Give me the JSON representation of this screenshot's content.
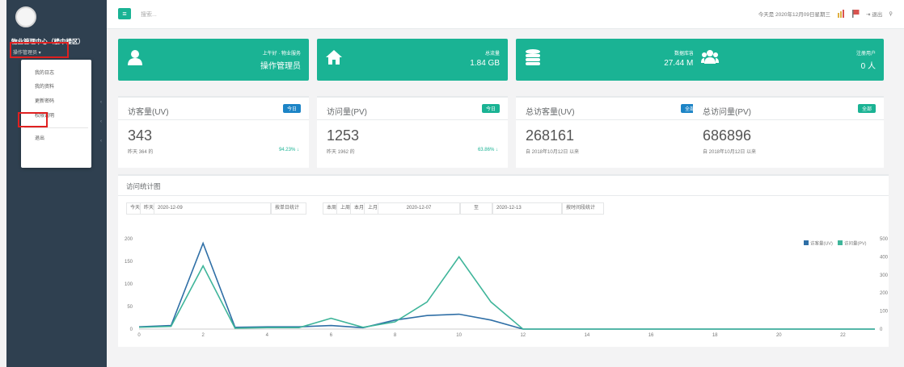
{
  "sidebar": {
    "profile_name": "物业管理中心（楼中楼区）",
    "profile_role": "操作管理员 ▾",
    "menu": [
      "我的日志",
      "我的资料",
      "更新密码",
      "权限说明",
      "退出"
    ]
  },
  "topbar": {
    "search_placeholder": "搜索...",
    "date_text": "今天是 2020年12月09日星期三",
    "logout_label": "退出"
  },
  "stat_boxes": [
    {
      "label": "上午好 · 物业服务",
      "value": "操作管理员",
      "icon": "user-icon"
    },
    {
      "label": "总流量",
      "value": "1.84 GB",
      "icon": "home-icon"
    },
    {
      "label": "数据库容量",
      "value": "27.44 MB",
      "icon": "database-icon"
    },
    {
      "label": "注册用户",
      "value": "0 人",
      "icon": "users-icon"
    }
  ],
  "cards": [
    {
      "title": "访客量(UV)",
      "badge": "今日",
      "badge_color": "#1c84c6",
      "num": "343",
      "sub": "昨天 364 的",
      "pct": "94.23% ↓"
    },
    {
      "title": "访问量(PV)",
      "badge": "今日",
      "badge_color": "#1ab394",
      "num": "1253",
      "sub": "昨天 1962 的",
      "pct": "63.86% ↓"
    },
    {
      "title": "总访客量(UV)",
      "badge": "全部",
      "badge_color": "#1c84c6",
      "num": "268161",
      "sub": "自 2018年10月12日 以来",
      "pct": ""
    },
    {
      "title": "总访问量(PV)",
      "badge": "全部",
      "badge_color": "#1ab394",
      "num": "686896",
      "sub": "自 2018年10月12日 以来",
      "pct": ""
    }
  ],
  "chart_panel": {
    "title": "访问统计图",
    "controls": {
      "today": "今天",
      "yesterday": "昨天",
      "date1": "2020-12-09",
      "by_day": "按单日统计",
      "this_week": "本周",
      "last_week": "上周",
      "this_month": "本月",
      "last_month": "上月",
      "date_from": "2020-12-07",
      "to": "至",
      "date_to": "2020-12-13",
      "by_range": "按时间段统计"
    }
  },
  "chart_data": {
    "type": "line",
    "x": [
      0,
      1,
      2,
      3,
      4,
      5,
      6,
      7,
      8,
      9,
      10,
      11,
      12,
      13,
      14,
      15,
      16,
      17,
      18,
      19,
      20,
      21,
      22,
      23
    ],
    "xticks": [
      0,
      2,
      4,
      6,
      8,
      10,
      12,
      14,
      16,
      18,
      20,
      22
    ],
    "series": [
      {
        "name": "访客量(UV)",
        "axis": "left",
        "color": "#2f6fa6",
        "values": [
          5,
          8,
          190,
          4,
          5,
          5,
          8,
          3,
          20,
          30,
          33,
          20,
          0,
          0,
          0,
          0,
          0,
          0,
          0,
          0,
          0,
          0,
          0,
          0
        ]
      },
      {
        "name": "访问量(PV)",
        "axis": "right",
        "color": "#3fb59a",
        "values": [
          10,
          15,
          350,
          5,
          8,
          8,
          60,
          10,
          40,
          150,
          400,
          150,
          0,
          0,
          0,
          0,
          0,
          0,
          0,
          0,
          0,
          0,
          0,
          0
        ]
      }
    ],
    "yticks_left": [
      0,
      50,
      100,
      150,
      200
    ],
    "yticks_right": [
      0,
      100,
      200,
      300,
      400,
      500
    ],
    "ylim_left": [
      0,
      200
    ],
    "ylim_right": [
      0,
      500
    ],
    "legend": "top-right"
  }
}
